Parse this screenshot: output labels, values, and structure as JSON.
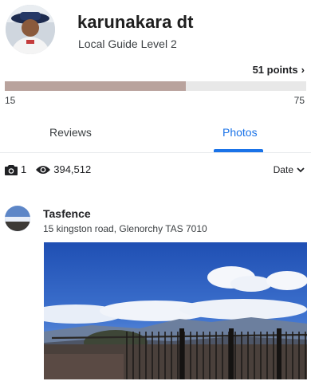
{
  "profile": {
    "name": "karunakara dt",
    "level": "Local Guide Level 2",
    "points_label": "51 points",
    "progress_min": "15",
    "progress_max": "75",
    "progress_value": 51
  },
  "tabs": [
    {
      "label": "Reviews",
      "selected": false
    },
    {
      "label": "Photos",
      "selected": true
    }
  ],
  "stats": {
    "photo_count": "1",
    "view_count": "394,512",
    "sort_label": "Date"
  },
  "post": {
    "place_name": "Tasfence",
    "address": "15 kingston road, Glenorchy TAS 7010"
  },
  "colors": {
    "accent": "#1a73e8",
    "progress_fill": "#b9a39d",
    "progress_track": "#e8e8e8"
  },
  "icons": {
    "points_chevron": "chevron-right-icon",
    "photo_count": "camera-icon",
    "view_count": "eye-icon",
    "sort_chevron": "chevron-down-icon"
  }
}
